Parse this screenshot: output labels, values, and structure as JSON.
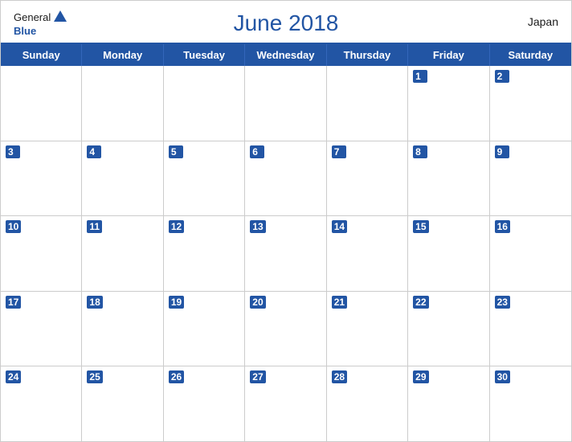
{
  "header": {
    "title": "June 2018",
    "country": "Japan",
    "logo_general": "General",
    "logo_blue": "Blue"
  },
  "days_of_week": [
    "Sunday",
    "Monday",
    "Tuesday",
    "Wednesday",
    "Thursday",
    "Friday",
    "Saturday"
  ],
  "weeks": [
    [
      {
        "date": null
      },
      {
        "date": null
      },
      {
        "date": null
      },
      {
        "date": null
      },
      {
        "date": null
      },
      {
        "date": 1
      },
      {
        "date": 2
      }
    ],
    [
      {
        "date": 3
      },
      {
        "date": 4
      },
      {
        "date": 5
      },
      {
        "date": 6
      },
      {
        "date": 7
      },
      {
        "date": 8
      },
      {
        "date": 9
      }
    ],
    [
      {
        "date": 10
      },
      {
        "date": 11
      },
      {
        "date": 12
      },
      {
        "date": 13
      },
      {
        "date": 14
      },
      {
        "date": 15
      },
      {
        "date": 16
      }
    ],
    [
      {
        "date": 17
      },
      {
        "date": 18
      },
      {
        "date": 19
      },
      {
        "date": 20
      },
      {
        "date": 21
      },
      {
        "date": 22
      },
      {
        "date": 23
      }
    ],
    [
      {
        "date": 24
      },
      {
        "date": 25
      },
      {
        "date": 26
      },
      {
        "date": 27
      },
      {
        "date": 28
      },
      {
        "date": 29
      },
      {
        "date": 30
      }
    ]
  ]
}
